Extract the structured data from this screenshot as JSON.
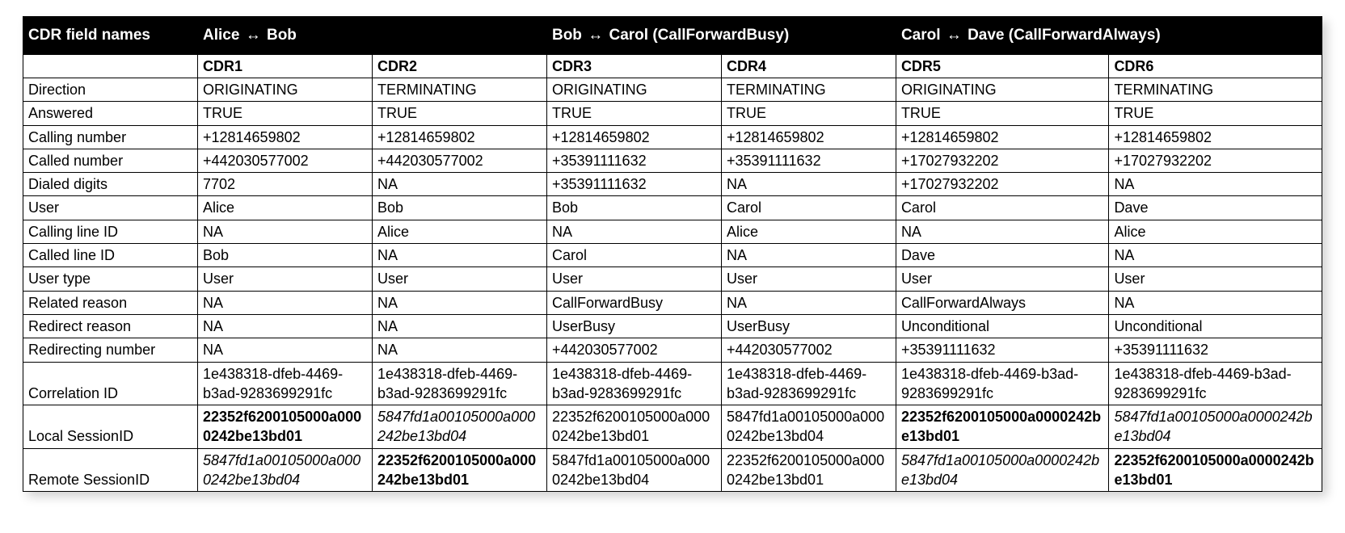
{
  "header": {
    "fieldnames_label": "CDR field names",
    "groups": [
      {
        "party_a": "Alice",
        "party_b": "Bob",
        "suffix": ""
      },
      {
        "party_a": "Bob",
        "party_b": "Carol",
        "suffix": " (CallForwardBusy)"
      },
      {
        "party_a": "Carol",
        "party_b": "Dave",
        "suffix": " (CallForwardAlways)"
      }
    ],
    "cdr_labels": [
      "CDR1",
      "CDR2",
      "CDR3",
      "CDR4",
      "CDR5",
      "CDR6"
    ]
  },
  "rows": [
    {
      "label": "Direction",
      "cells": [
        {
          "text": "ORIGINATING"
        },
        {
          "text": "TERMINATING"
        },
        {
          "text": "ORIGINATING"
        },
        {
          "text": "TERMINATING"
        },
        {
          "text": "ORIGINATING"
        },
        {
          "text": "TERMINATING"
        }
      ]
    },
    {
      "label": "Answered",
      "cells": [
        {
          "text": "TRUE"
        },
        {
          "text": "TRUE"
        },
        {
          "text": "TRUE"
        },
        {
          "text": "TRUE"
        },
        {
          "text": "TRUE"
        },
        {
          "text": "TRUE"
        }
      ]
    },
    {
      "label": "Calling number",
      "cells": [
        {
          "text": "+12814659802"
        },
        {
          "text": "+12814659802"
        },
        {
          "text": "+12814659802"
        },
        {
          "text": "+12814659802"
        },
        {
          "text": "+12814659802"
        },
        {
          "text": "+12814659802"
        }
      ]
    },
    {
      "label": "Called number",
      "cells": [
        {
          "text": "+442030577002"
        },
        {
          "text": "+442030577002"
        },
        {
          "text": "+35391111632"
        },
        {
          "text": "+35391111632"
        },
        {
          "text": "+17027932202"
        },
        {
          "text": "+17027932202"
        }
      ]
    },
    {
      "label": "Dialed digits",
      "cells": [
        {
          "text": "7702"
        },
        {
          "text": "NA"
        },
        {
          "text": "+35391111632"
        },
        {
          "text": "NA"
        },
        {
          "text": "+17027932202"
        },
        {
          "text": "NA"
        }
      ]
    },
    {
      "label": "User",
      "cells": [
        {
          "text": "Alice"
        },
        {
          "text": "Bob"
        },
        {
          "text": "Bob"
        },
        {
          "text": "Carol"
        },
        {
          "text": "Carol"
        },
        {
          "text": "Dave"
        }
      ]
    },
    {
      "label": "Calling line ID",
      "cells": [
        {
          "text": "NA"
        },
        {
          "text": "Alice"
        },
        {
          "text": "NA"
        },
        {
          "text": "Alice"
        },
        {
          "text": "NA"
        },
        {
          "text": "Alice"
        }
      ]
    },
    {
      "label": "Called line ID",
      "cells": [
        {
          "text": "Bob"
        },
        {
          "text": "NA"
        },
        {
          "text": "Carol"
        },
        {
          "text": "NA"
        },
        {
          "text": "Dave"
        },
        {
          "text": "NA"
        }
      ]
    },
    {
      "label": "User type",
      "cells": [
        {
          "text": "User"
        },
        {
          "text": "User"
        },
        {
          "text": "User"
        },
        {
          "text": "User"
        },
        {
          "text": "User"
        },
        {
          "text": "User"
        }
      ]
    },
    {
      "label": "Related reason",
      "cells": [
        {
          "text": "NA"
        },
        {
          "text": "NA"
        },
        {
          "text": "CallForwardBusy"
        },
        {
          "text": "NA"
        },
        {
          "text": "CallForwardAlways"
        },
        {
          "text": "NA"
        }
      ]
    },
    {
      "label": "Redirect reason",
      "cells": [
        {
          "text": "NA"
        },
        {
          "text": "NA"
        },
        {
          "text": "UserBusy"
        },
        {
          "text": "UserBusy"
        },
        {
          "text": "Unconditional"
        },
        {
          "text": "Unconditional"
        }
      ]
    },
    {
      "label": "Redirecting number",
      "cells": [
        {
          "text": "NA"
        },
        {
          "text": "NA"
        },
        {
          "text": "+442030577002"
        },
        {
          "text": "+442030577002"
        },
        {
          "text": "+35391111632"
        },
        {
          "text": "+35391111632"
        }
      ]
    },
    {
      "label": "Correlation ID",
      "cells": [
        {
          "text": "1e438318-dfeb-4469-b3ad-9283699291fc"
        },
        {
          "text": "1e438318-dfeb-4469-b3ad-9283699291fc"
        },
        {
          "text": "1e438318-dfeb-4469-b3ad-9283699291fc"
        },
        {
          "text": "1e438318-dfeb-4469-b3ad-9283699291fc"
        },
        {
          "text": "1e438318-dfeb-4469-b3ad-9283699291fc"
        },
        {
          "text": "1e438318-dfeb-4469-b3ad-9283699291fc"
        }
      ]
    },
    {
      "label": "Local SessionID",
      "cells": [
        {
          "text": "22352f6200105000a0000242be13bd01",
          "style": "bold"
        },
        {
          "text": "5847fd1a00105000a000242be13bd04",
          "style": "ital"
        },
        {
          "text": "22352f6200105000a0000242be13bd01"
        },
        {
          "text": "5847fd1a00105000a0000242be13bd04"
        },
        {
          "text": "22352f6200105000a0000242be13bd01",
          "style": "bold"
        },
        {
          "text": "5847fd1a00105000a0000242be13bd04",
          "style": "ital"
        }
      ]
    },
    {
      "label": "Remote SessionID",
      "cells": [
        {
          "text": "5847fd1a00105000a0000242be13bd04",
          "style": "ital"
        },
        {
          "text": "22352f6200105000a000242be13bd01",
          "style": "bold"
        },
        {
          "text": "5847fd1a00105000a0000242be13bd04"
        },
        {
          "text": "22352f6200105000a0000242be13bd01"
        },
        {
          "text": "5847fd1a00105000a0000242be13bd04",
          "style": "ital"
        },
        {
          "text": "22352f6200105000a0000242be13bd01",
          "style": "bold"
        }
      ]
    }
  ],
  "glyphs": {
    "double_arrow": "↔"
  }
}
